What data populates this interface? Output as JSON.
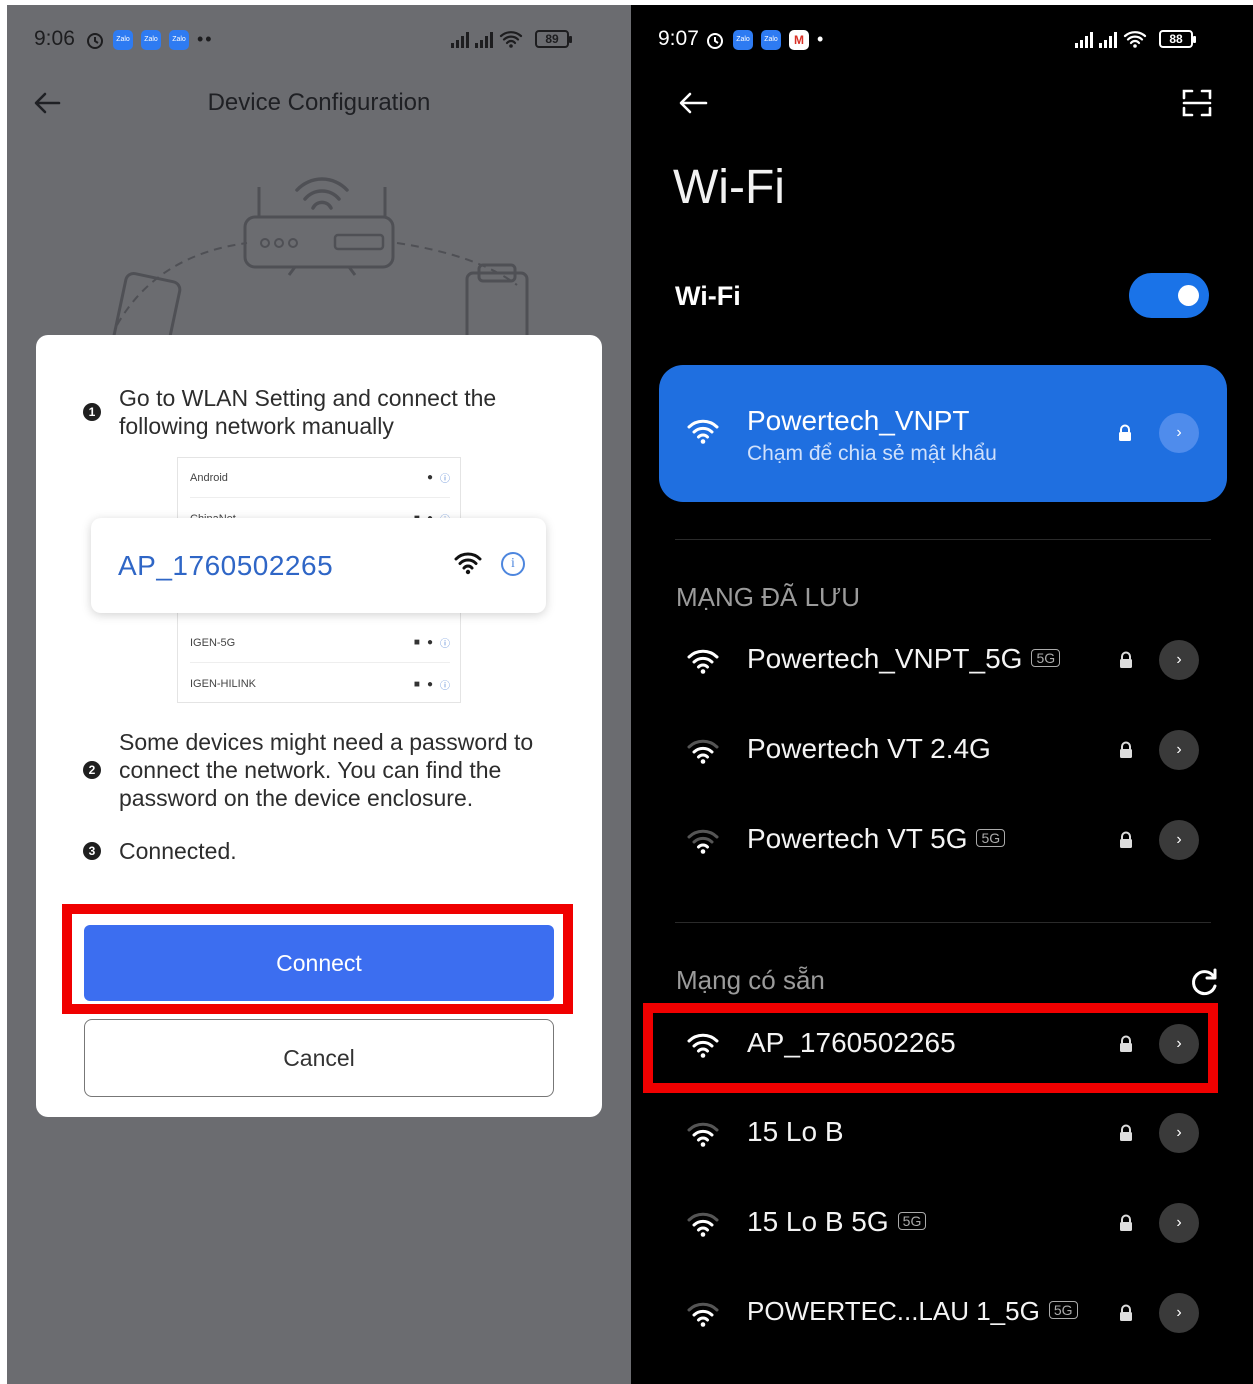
{
  "left_phone": {
    "status_bar": {
      "time": "9:06",
      "battery": "89",
      "notif_icons": [
        "Zalo",
        "Zalo",
        "Zalo"
      ],
      "dots": "••"
    },
    "header": {
      "title": "Device Configuration"
    },
    "dialog": {
      "steps": [
        {
          "number": "1",
          "text": "Go to WLAN Setting and connect the following network manually"
        },
        {
          "number": "2",
          "text": "Some devices might need a password to connect the network. You can find the password on the device enclosure."
        },
        {
          "number": "3",
          "text": "Connected."
        }
      ],
      "mini_list": [
        "Android",
        "ChinaNet",
        "IGEN-5G",
        "IGEN-HILINK"
      ],
      "ap_network": "AP_1760502265",
      "connect_label": "Connect",
      "cancel_label": "Cancel"
    }
  },
  "right_phone": {
    "status_bar": {
      "time": "9:07",
      "battery": "88",
      "notif_icons": [
        "Zalo",
        "Zalo",
        "M"
      ],
      "dots": "•"
    },
    "title": "Wi-Fi",
    "wifi_toggle_label": "Wi-Fi",
    "wifi_enabled": true,
    "connected": {
      "name": "Powertech_VNPT",
      "subtitle": "Chạm để chia sẻ mật khẩu"
    },
    "saved_section": {
      "title": "MẠNG ĐÃ LƯU",
      "networks": [
        {
          "name": "Powertech_VNPT_5G",
          "badge": "5G"
        },
        {
          "name": "Powertech VT 2.4G",
          "badge": ""
        },
        {
          "name": "Powertech VT 5G",
          "badge": "5G"
        }
      ]
    },
    "available_section": {
      "title": "Mạng có sẵn",
      "networks": [
        {
          "name": "AP_1760502265",
          "badge": ""
        },
        {
          "name": "15 Lo B",
          "badge": ""
        },
        {
          "name": "15 Lo B 5G",
          "badge": "5G"
        },
        {
          "name": "POWERTEC...LAU 1_5G",
          "badge": "5G"
        }
      ]
    }
  },
  "colors": {
    "highlight": "#f00000",
    "connect_button": "#3c6ef0",
    "connected_card": "#1f6fe0",
    "toggle": "#1a73e8"
  }
}
